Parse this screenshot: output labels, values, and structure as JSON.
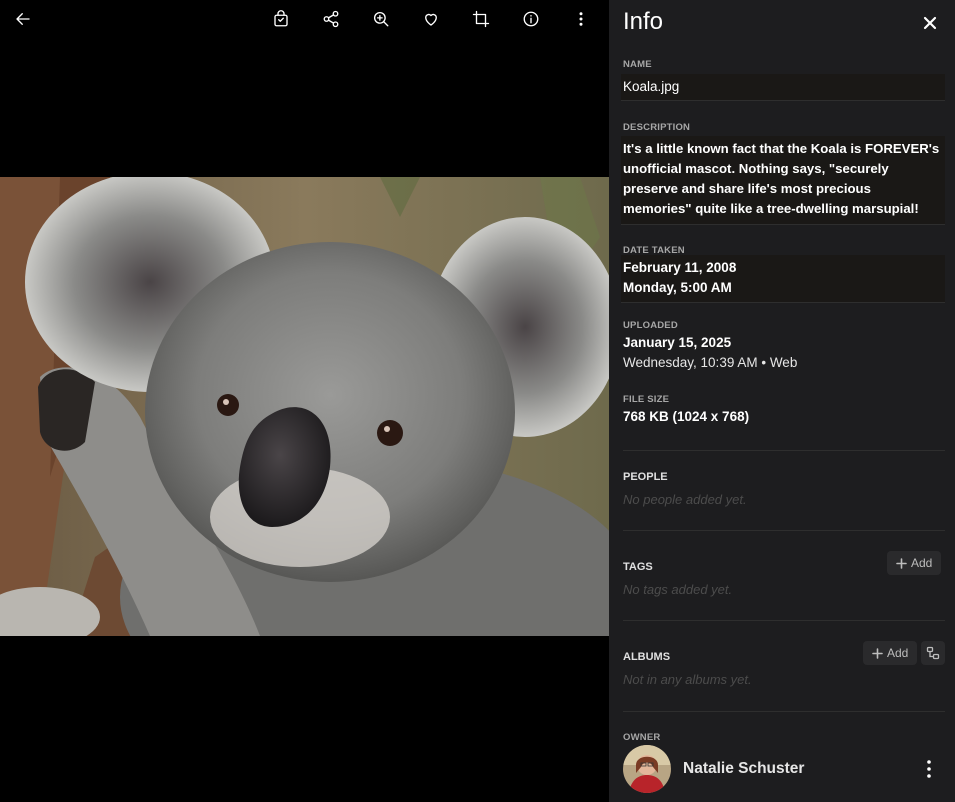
{
  "toolbar": {
    "back": "arrow-left-icon",
    "icons": [
      "shopping-bag-icon",
      "share-icon",
      "zoom-in-icon",
      "heart-icon",
      "crop-icon",
      "info-icon",
      "more-vert-icon"
    ]
  },
  "info": {
    "title": "Info",
    "name_label": "NAME",
    "name_value": "Koala.jpg",
    "description_label": "DESCRIPTION",
    "description_value": "It's a little known fact that the Koala is FOREVER's unofficial mascot. Nothing says, \"securely preserve and share life's most precious memories\" quite like a tree-dwelling marsupial!",
    "date_taken_label": "DATE TAKEN",
    "date_taken_date": "February 11, 2008",
    "date_taken_time": "Monday, 5:00 AM",
    "uploaded_label": "UPLOADED",
    "uploaded_date": "January 15, 2025",
    "uploaded_time": "Wednesday, 10:39 AM • Web",
    "file_size_label": "FILE SIZE",
    "file_size_value": "768 KB (1024 x 768)",
    "people_title": "PEOPLE",
    "people_empty": "No people added yet.",
    "tags_title": "TAGS",
    "tags_add": "Add",
    "tags_empty": "No tags added yet.",
    "albums_title": "ALBUMS",
    "albums_add": "Add",
    "albums_empty": "Not in any albums yet.",
    "owner_label": "OWNER",
    "owner_name": "Natalie Schuster"
  }
}
